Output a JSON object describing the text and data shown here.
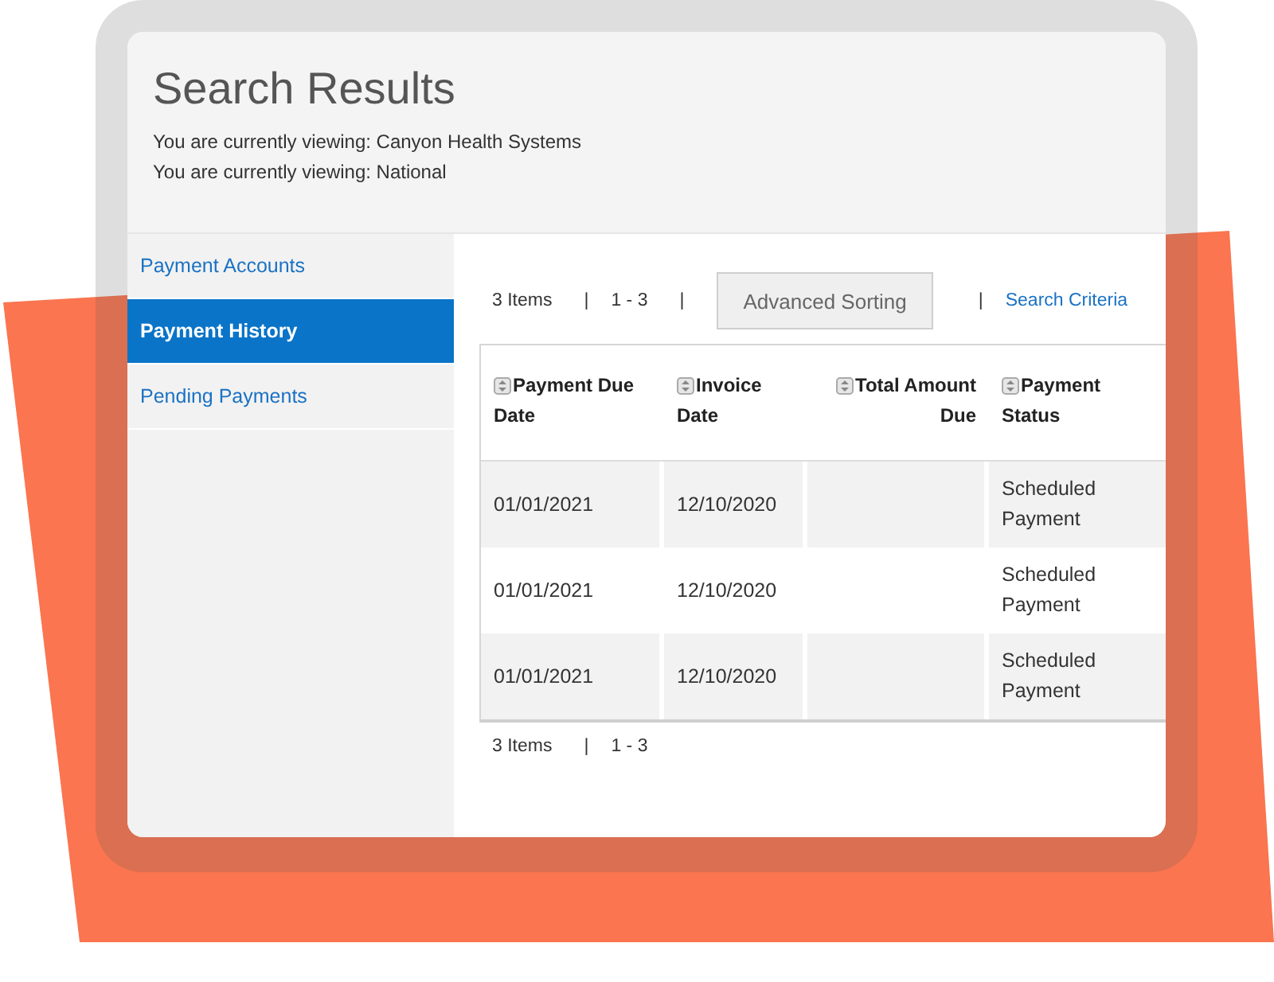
{
  "header": {
    "title": "Search Results",
    "context_lines": [
      "You are currently viewing: Canyon Health Systems",
      "You are currently viewing: National"
    ]
  },
  "sidebar": {
    "items": [
      {
        "label": "Payment Accounts",
        "selected": false
      },
      {
        "label": "Payment History",
        "selected": true
      },
      {
        "label": "Pending Payments",
        "selected": false
      }
    ]
  },
  "toolbar": [
    {
      "kind": "text",
      "text": "3 Items"
    },
    {
      "kind": "separator",
      "text": "|"
    },
    {
      "kind": "text",
      "text": "1 - 3"
    },
    {
      "kind": "separator",
      "text": "|"
    },
    {
      "kind": "button",
      "text": "Advanced Sorting"
    },
    {
      "kind": "separator",
      "text": "|"
    },
    {
      "kind": "link",
      "text": "Search Criteria"
    }
  ],
  "table": {
    "columns": [
      {
        "label": "Payment Due Date"
      },
      {
        "label": "Invoice Date"
      },
      {
        "label": "Total Amount Due"
      },
      {
        "label": "Payment Status"
      }
    ],
    "rows": [
      {
        "cells": [
          "01/01/2021",
          "12/10/2020",
          null,
          "Scheduled Payment"
        ]
      },
      {
        "cells": [
          "01/01/2021",
          "12/10/2020",
          null,
          "Scheduled Payment"
        ]
      },
      {
        "cells": [
          "01/01/2021",
          "12/10/2020",
          null,
          "Scheduled Payment"
        ]
      }
    ]
  },
  "footer": [
    {
      "kind": "text",
      "text": "3 Items"
    },
    {
      "kind": "separator",
      "text": "|"
    },
    {
      "kind": "text",
      "text": "1 - 3"
    }
  ]
}
